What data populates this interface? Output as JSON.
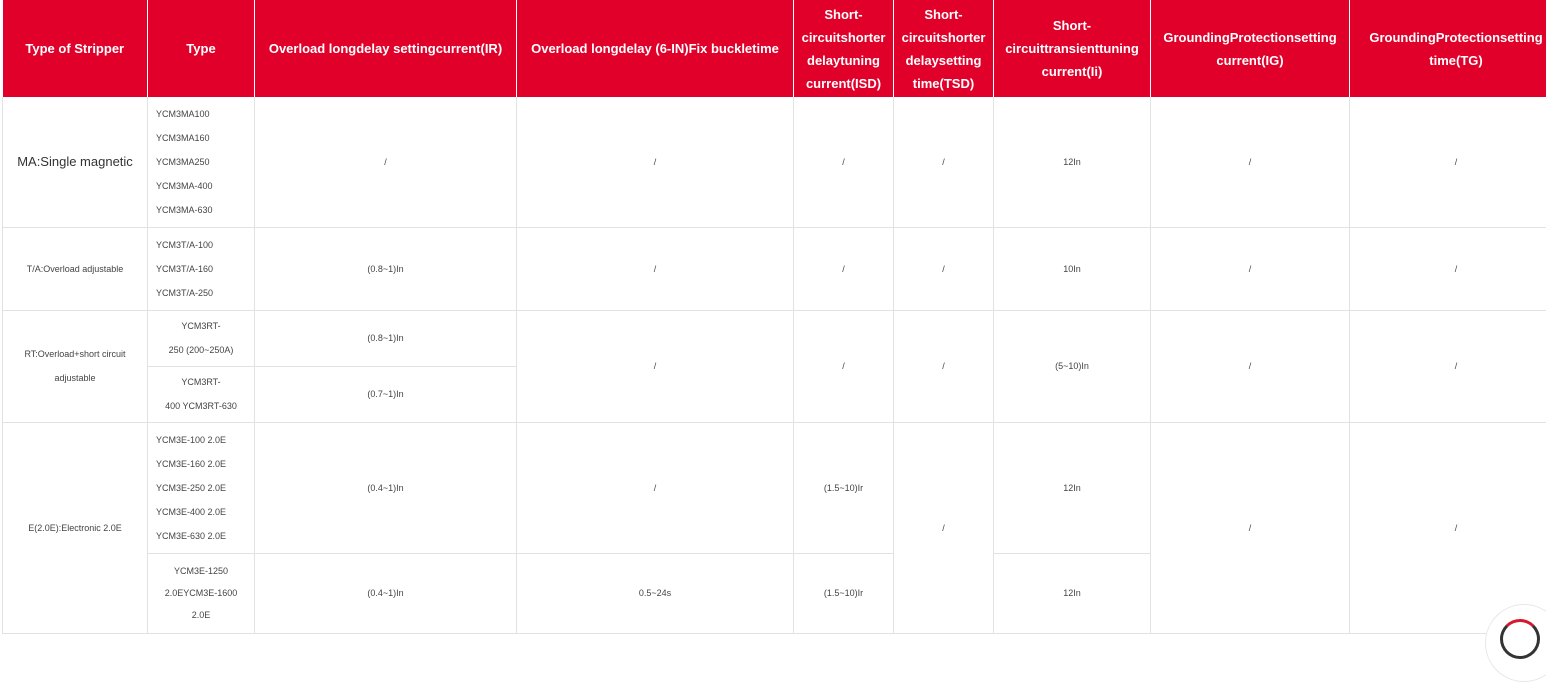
{
  "table": {
    "headers": [
      "Type of Stripper",
      "Type",
      "Overload longdelay settingcurrent(IR)",
      "Overload longdelay (6-IN)Fix buckletime",
      "Short-circuitshorter delaytuning current(ISD)",
      "Short-circuitshorter delaysetting time(TSD)",
      "Short-circuittransienttuning current(Ii)",
      "GroundingProtectionsetting current(IG)",
      "GroundingProtectionsetting time(TG)"
    ],
    "rows": {
      "ma": {
        "stripper": "MA:Single magnetic",
        "models": [
          "YCM3MA100",
          "YCM3MA160",
          "YCM3MA250",
          "YCM3MA-400",
          "YCM3MA-630"
        ],
        "ir": "/",
        "fix": "/",
        "isd": "/",
        "tsd": "/",
        "ii": "12In",
        "ig": "/",
        "tg": "/"
      },
      "ta": {
        "stripper": "T/A:Overload adjustable",
        "models": [
          "YCM3T/A-100",
          "YCM3T/A-160",
          "YCM3T/A-250"
        ],
        "ir": "(0.8~1)In",
        "fix": "/",
        "isd": "/",
        "tsd": "/",
        "ii": "10In",
        "ig": "/",
        "tg": "/"
      },
      "rt": {
        "stripper_line1": "RT:Overload+short circuit",
        "stripper_line2": "adjustable",
        "sub1": {
          "model_line1": "YCM3RT-",
          "model_line2": "250 (200~250A)",
          "ir": "(0.8~1)In"
        },
        "sub2": {
          "model_line1": "YCM3RT-",
          "model_line2": "400 YCM3RT-630",
          "ir": "(0.7~1)In"
        },
        "fix": "/",
        "isd": "/",
        "tsd": "/",
        "ii": "(5~10)In",
        "ig": "/",
        "tg": "/"
      },
      "e": {
        "stripper": "E(2.0E):Electronic 2.0E",
        "sub1": {
          "models": [
            "YCM3E-100  2.0E",
            "YCM3E-160 2.0E",
            "YCM3E-250 2.0E",
            "YCM3E-400 2.0E",
            "YCM3E-630 2.0E"
          ],
          "ir": "(0.4~1)In",
          "fix": "/",
          "isd": "(1.5~10)Ir",
          "ii": "12In"
        },
        "sub2": {
          "models": [
            "YCM3E-1250",
            "2.0EYCM3E-1600",
            "2.0E"
          ],
          "ir": "(0.4~1)In",
          "fix": "0.5~24s",
          "isd": "(1.5~10)Ir",
          "ii": "12In"
        },
        "tsd": "/",
        "ig": "/",
        "tg": "/"
      }
    }
  },
  "colors": {
    "header_bg": "#e0002a",
    "header_text": "#ffffff",
    "border": "#e2e2e2"
  },
  "floating_icon": "chat-icon"
}
